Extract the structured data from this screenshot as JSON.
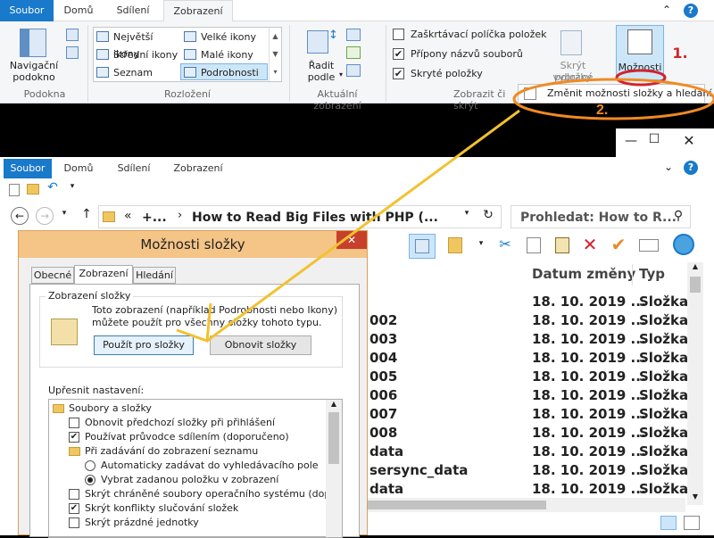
{
  "top_window": {
    "tabs": [
      "Soubor",
      "Domů",
      "Sdílení",
      "Zobrazení"
    ],
    "groups": {
      "podokna": {
        "label": "Podokna",
        "nav_pane_line1": "Navigační",
        "nav_pane_line2": "podokno"
      },
      "rozlozeni": {
        "label": "Rozložení",
        "items": [
          "Největší ikony",
          "Velké ikony",
          "Střední ikony",
          "Malé ikony",
          "Seznam",
          "Podrobnosti"
        ]
      },
      "aktualni": {
        "label": "Aktuální zobrazení",
        "sort_line1": "Řadit",
        "sort_line2": "podle"
      },
      "zobrazit": {
        "label": "Zobrazit či skrýt",
        "checkboxes": [
          {
            "label": "Zaškrtávací políčka položek",
            "checked": false
          },
          {
            "label": "Přípony názvů souborů",
            "checked": true
          },
          {
            "label": "Skryté položky",
            "checked": true
          }
        ],
        "hide_line1": "Skrýt vybrané",
        "hide_line2": "položky"
      },
      "options_label": "Možnosti"
    },
    "dropdown_item": "Změnit možnosti složky a hledání"
  },
  "annotations": {
    "step1": "1.",
    "step2": "2."
  },
  "bottom_window": {
    "tabs": [
      "Soubor",
      "Domů",
      "Sdílení",
      "Zobrazení"
    ],
    "address": {
      "prefix": "«",
      "ellipsis": "+...",
      "path": "How to Read Big Files with PHP (...",
      "search_placeholder": "Prohledat: How to R..."
    },
    "columns": {
      "date": "Datum změny",
      "type": "Typ"
    },
    "rows": [
      {
        "name": "",
        "date": "18. 10. 2019 ...",
        "type": "Složka"
      },
      {
        "name": "002",
        "date": "18. 10. 2019 ...",
        "type": "Složka"
      },
      {
        "name": "003",
        "date": "18. 10. 2019 ...",
        "type": "Složka"
      },
      {
        "name": "004",
        "date": "18. 10. 2019 ...",
        "type": "Složka"
      },
      {
        "name": "005",
        "date": "18. 10. 2019 ...",
        "type": "Složka"
      },
      {
        "name": "006",
        "date": "18. 10. 2019 ...",
        "type": "Složka"
      },
      {
        "name": "007",
        "date": "18. 10. 2019 ...",
        "type": "Složka"
      },
      {
        "name": "008",
        "date": "18. 10. 2019 ...",
        "type": "Složka"
      },
      {
        "name": "data",
        "date": "18. 10. 2019 ...",
        "type": "Složka"
      },
      {
        "name": "sersync_data",
        "date": "18. 10. 2019 ...",
        "type": "Složka"
      },
      {
        "name": "data",
        "date": "18. 10. 2019 ...",
        "type": "Složka"
      }
    ]
  },
  "dialog": {
    "title": "Možnosti složky",
    "tabs": [
      "Obecné",
      "Zobrazení",
      "Hledání"
    ],
    "group_title": "Zobrazení složky",
    "desc_line1": "Toto zobrazení (například Podrobnosti nebo Ikony)",
    "desc_line2": "můžete použít pro všechny složky tohoto typu.",
    "apply_button": "Použít pro složky",
    "reset_button": "Obnovit složky",
    "advanced_label": "Upřesnit nastavení:",
    "tree": [
      {
        "kind": "folder",
        "indent": 0,
        "label": "Soubory a složky"
      },
      {
        "kind": "check",
        "indent": 1,
        "label": "Obnovit předchozí složky při přihlášení",
        "checked": false
      },
      {
        "kind": "check",
        "indent": 1,
        "label": "Používat průvodce sdílením (doporučeno)",
        "checked": true
      },
      {
        "kind": "folder",
        "indent": 1,
        "label": "Při zadávání do zobrazení seznamu"
      },
      {
        "kind": "radio",
        "indent": 2,
        "label": "Automaticky zadávat do vyhledávacího pole",
        "checked": false
      },
      {
        "kind": "radio",
        "indent": 2,
        "label": "Vybrat zadanou položku v zobrazení",
        "checked": true
      },
      {
        "kind": "check",
        "indent": 1,
        "label": "Skrýt chráněné soubory operačního systému (doporučeno)",
        "checked": false
      },
      {
        "kind": "check",
        "indent": 1,
        "label": "Skrýt konflikty slučování složek",
        "checked": true
      },
      {
        "kind": "check",
        "indent": 1,
        "label": "Skrýt prázdné jednotky",
        "checked": false
      }
    ]
  },
  "colors": {
    "accent": "#1979ca",
    "annotation_red": "#d2222d",
    "annotation_orange": "#f08a24",
    "arrow_yellow": "#f2c12e",
    "dialog_title": "#f5c587"
  }
}
